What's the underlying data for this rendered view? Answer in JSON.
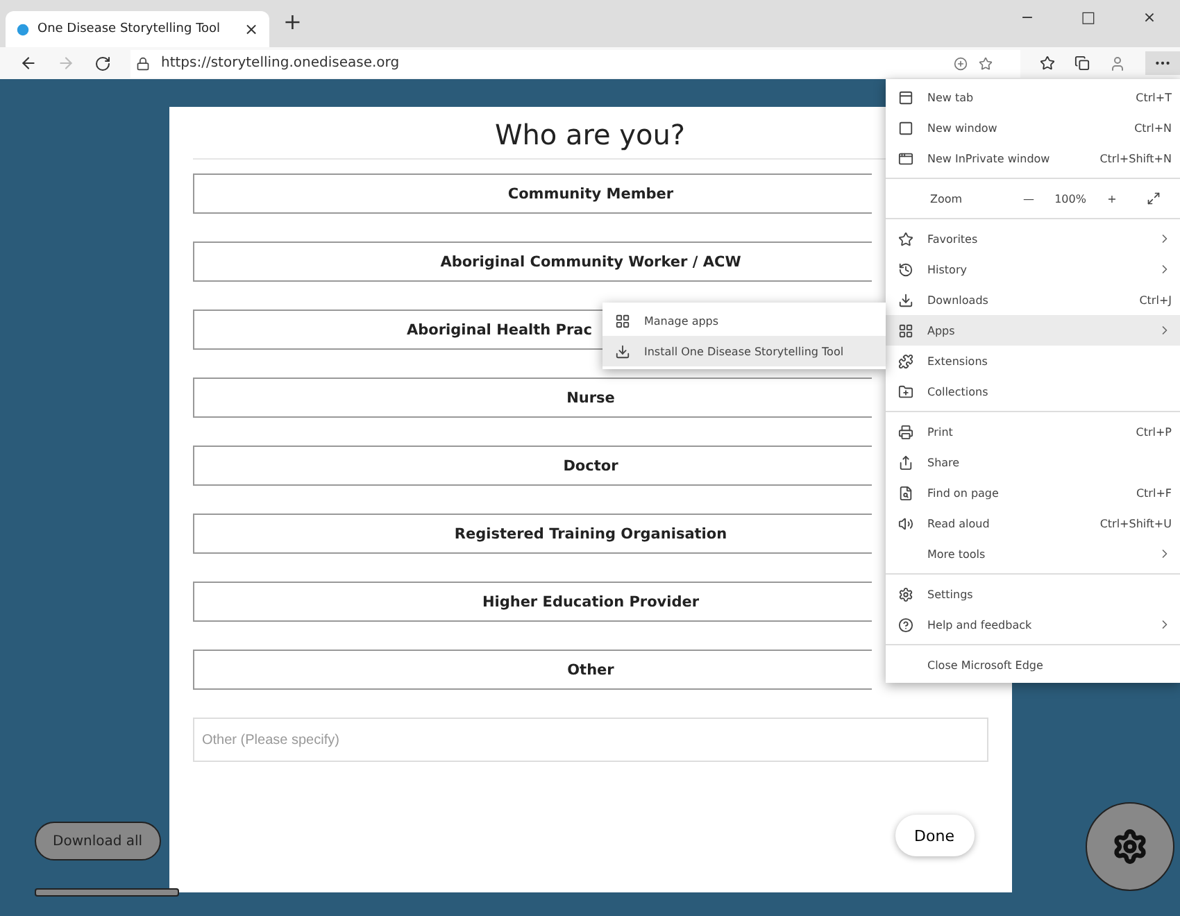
{
  "browser": {
    "tab": {
      "title": "One Disease Storytelling Tool",
      "close": "×"
    },
    "new_tab": "+",
    "window_controls": [
      "−",
      "□",
      "×"
    ],
    "url": "https://storytelling.onedisease.org"
  },
  "page": {
    "title": "Who are you?",
    "options": [
      {
        "label": "Community Member",
        "kind": "full"
      },
      {
        "label": "Aboriginal Community Worker / ACW",
        "kind": "full"
      },
      {
        "label": "Aboriginal Health Prac",
        "kind": "partly-hidden"
      },
      {
        "label": "Nurse",
        "kind": "full"
      },
      {
        "label": "Doctor",
        "kind": "full"
      },
      {
        "label": "Registered Training Organisation",
        "kind": "full"
      },
      {
        "label": "Higher Education Provider",
        "kind": "full"
      },
      {
        "label": "Other",
        "kind": "full"
      }
    ],
    "other_field": {
      "placeholder": "Other (Please specify)"
    },
    "done": "Done",
    "download_all": "Download all"
  },
  "menu": {
    "sections": [
      [
        {
          "kind": "item",
          "label": "New tab",
          "shortcut": "Ctrl+T",
          "highlighted": false,
          "submenu": false
        },
        {
          "kind": "item",
          "label": "New window",
          "shortcut": "Ctrl+N",
          "highlighted": false,
          "submenu": false
        },
        {
          "kind": "item",
          "label": "New InPrivate window",
          "shortcut": "Ctrl+Shift+N",
          "highlighted": false,
          "submenu": false
        }
      ],
      [
        {
          "kind": "zoom",
          "label": "Zoom",
          "minus": "—",
          "value": "100%",
          "plus": "+"
        }
      ],
      [
        {
          "kind": "item",
          "label": "Favorites",
          "highlighted": false,
          "submenu": true
        },
        {
          "kind": "item",
          "label": "History",
          "highlighted": false,
          "submenu": true
        },
        {
          "kind": "item",
          "label": "Downloads",
          "shortcut": "Ctrl+J",
          "highlighted": false,
          "submenu": false
        },
        {
          "kind": "item",
          "label": "Apps",
          "highlighted": true,
          "submenu": true
        },
        {
          "kind": "item",
          "label": "Extensions",
          "highlighted": false,
          "submenu": false
        },
        {
          "kind": "item",
          "label": "Collections",
          "highlighted": false,
          "submenu": false
        }
      ],
      [
        {
          "kind": "item",
          "label": "Print",
          "shortcut": "Ctrl+P",
          "highlighted": false,
          "submenu": false
        },
        {
          "kind": "item",
          "label": "Share",
          "highlighted": false,
          "submenu": false
        },
        {
          "kind": "item",
          "label": "Find on page",
          "shortcut": "Ctrl+F",
          "highlighted": false,
          "submenu": false
        },
        {
          "kind": "item",
          "label": "Read aloud",
          "shortcut": "Ctrl+Shift+U",
          "highlighted": false,
          "submenu": false
        },
        {
          "kind": "item",
          "label": "More tools",
          "highlighted": false,
          "submenu": true
        }
      ],
      [
        {
          "kind": "item",
          "label": "Settings",
          "highlighted": false,
          "submenu": false
        },
        {
          "kind": "item",
          "label": "Help and feedback",
          "highlighted": false,
          "submenu": true
        }
      ],
      [
        {
          "kind": "item",
          "label": "Close Microsoft Edge",
          "highlighted": false,
          "submenu": false
        }
      ]
    ]
  },
  "apps_submenu": [
    {
      "label": "Manage apps",
      "highlighted": false
    },
    {
      "label": "Install One Disease Storytelling Tool",
      "highlighted": true
    }
  ]
}
